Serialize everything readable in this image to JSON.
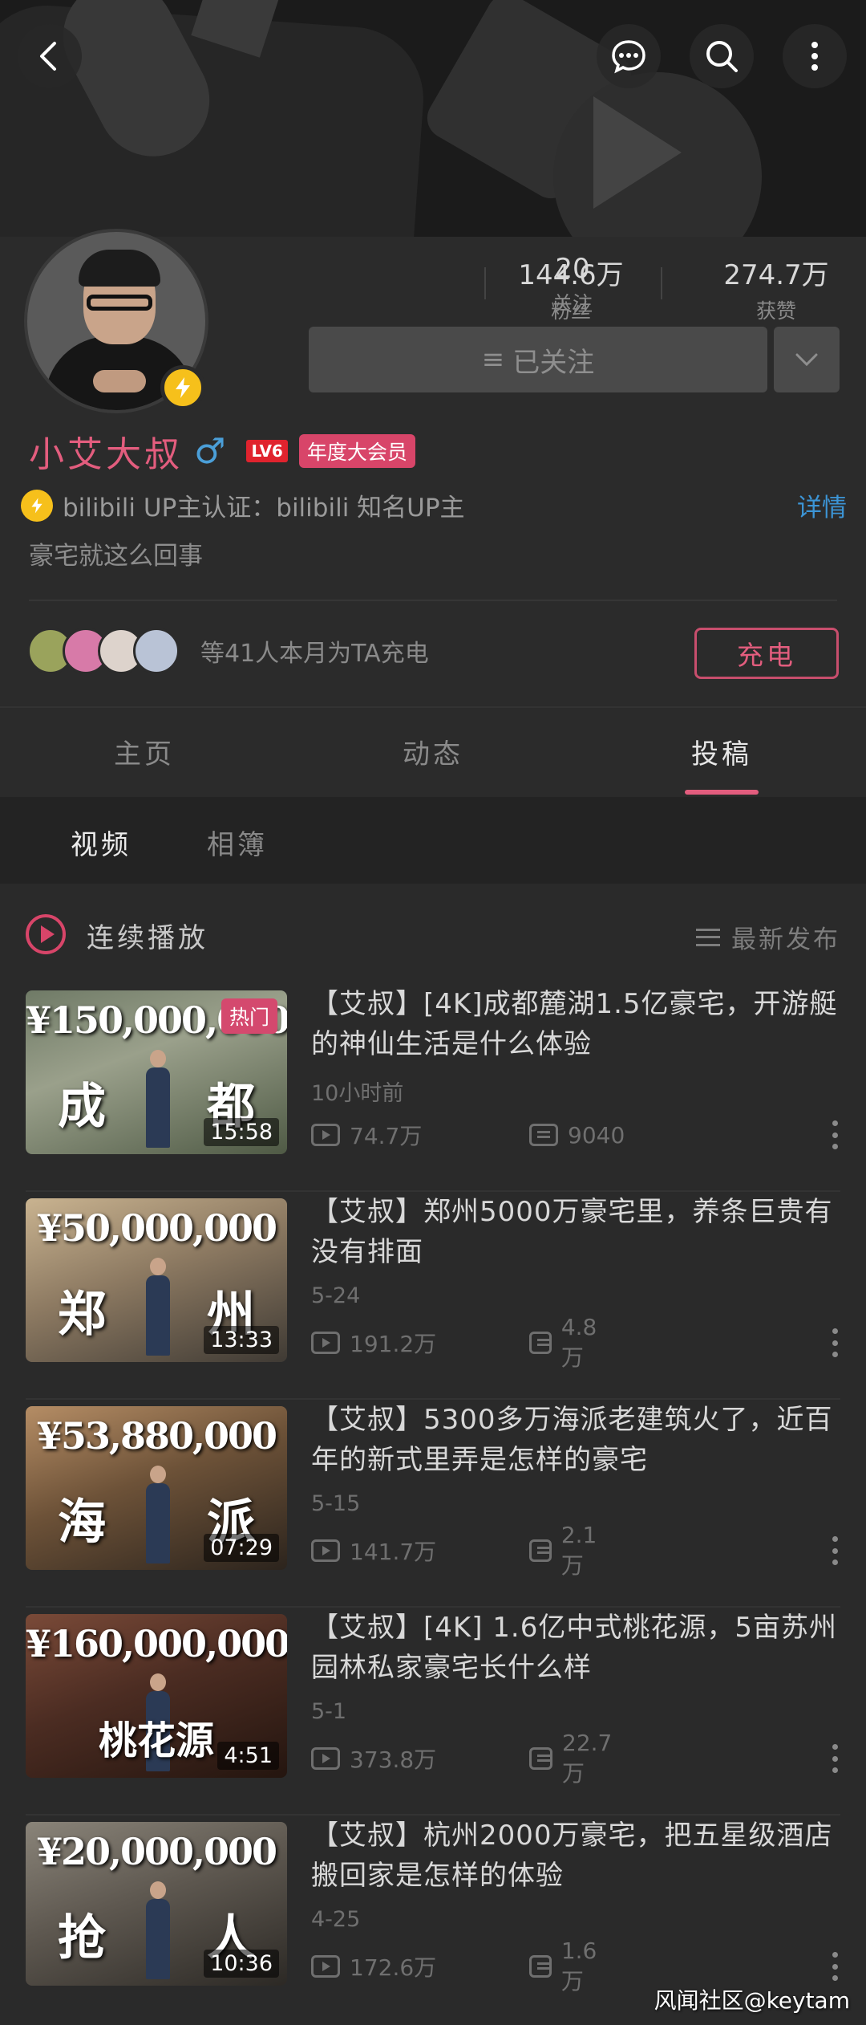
{
  "header": {
    "back_icon": "chevron-left-icon",
    "message_icon": "chat-bubble-icon",
    "search_icon": "search-icon",
    "more_icon": "more-vertical-icon"
  },
  "profile": {
    "stats": [
      {
        "value": "144.6万",
        "label": "粉丝"
      },
      {
        "value": "20",
        "label": "关注"
      },
      {
        "value": "274.7万",
        "label": "获赞"
      }
    ],
    "follow_label": "已关注",
    "name": "小艾大叔",
    "gender": "♂",
    "level": "LV6",
    "vip_badge": "年度大会员",
    "certification": "bilibili UP主认证：bilibili 知名UP主",
    "detail_link": "详情",
    "bio": "豪宅就这么回事",
    "charge_text": "等41人本月为TA充电",
    "charge_button": "充电"
  },
  "tabs": [
    {
      "label": "主页"
    },
    {
      "label": "动态"
    },
    {
      "label": "投稿"
    }
  ],
  "active_tab": "投稿",
  "subtabs": [
    {
      "label": "视频"
    },
    {
      "label": "相簿"
    }
  ],
  "list_header": {
    "continuous_play": "连续播放",
    "sort": "最新发布"
  },
  "videos": [
    {
      "title": "【艾叔】[4K]成都麓湖1.5亿豪宅，开游艇的神仙生活是什么体验",
      "date": "10小时前",
      "views": "74.7万",
      "danmaku": "9040",
      "duration": "15:58",
      "badge": "热门",
      "thumb_price": "¥150,000,000",
      "thumb_city": [
        "成",
        "都"
      ]
    },
    {
      "title": "【艾叔】郑州5000万豪宅里，养条巨贵有没有排面",
      "date": "5-24",
      "views": "191.2万",
      "danmaku": "4.8万",
      "duration": "13:33",
      "thumb_price": "¥50,000,000",
      "thumb_city": [
        "郑",
        "州"
      ]
    },
    {
      "title": "【艾叔】5300多万海派老建筑火了，近百年的新式里弄是怎样的豪宅",
      "date": "5-15",
      "views": "141.7万",
      "danmaku": "2.1万",
      "duration": "07:29",
      "thumb_price": "¥53,880,000",
      "thumb_city": [
        "海",
        "派"
      ]
    },
    {
      "title": "【艾叔】[4K] 1.6亿中式桃花源，5亩苏州园林私家豪宅长什么样",
      "date": "5-1",
      "views": "373.8万",
      "danmaku": "22.7万",
      "duration": "4:51",
      "thumb_price": "¥160,000,000",
      "thumb_city": [
        "桃花源"
      ]
    },
    {
      "title": "【艾叔】杭州2000万豪宅，把五星级酒店搬回家是怎样的体验",
      "date": "4-25",
      "views": "172.6万",
      "danmaku": "1.6万",
      "duration": "10:36",
      "thumb_price": "¥20,000,000",
      "thumb_city": [
        "抢",
        "人"
      ]
    }
  ],
  "watermark": "风闻社区@keytam",
  "colors": {
    "accent_pink": "#e35d7e",
    "link_blue": "#3c95d6",
    "background": "#2a2a2a",
    "bolt_yellow": "#f6c01b"
  }
}
